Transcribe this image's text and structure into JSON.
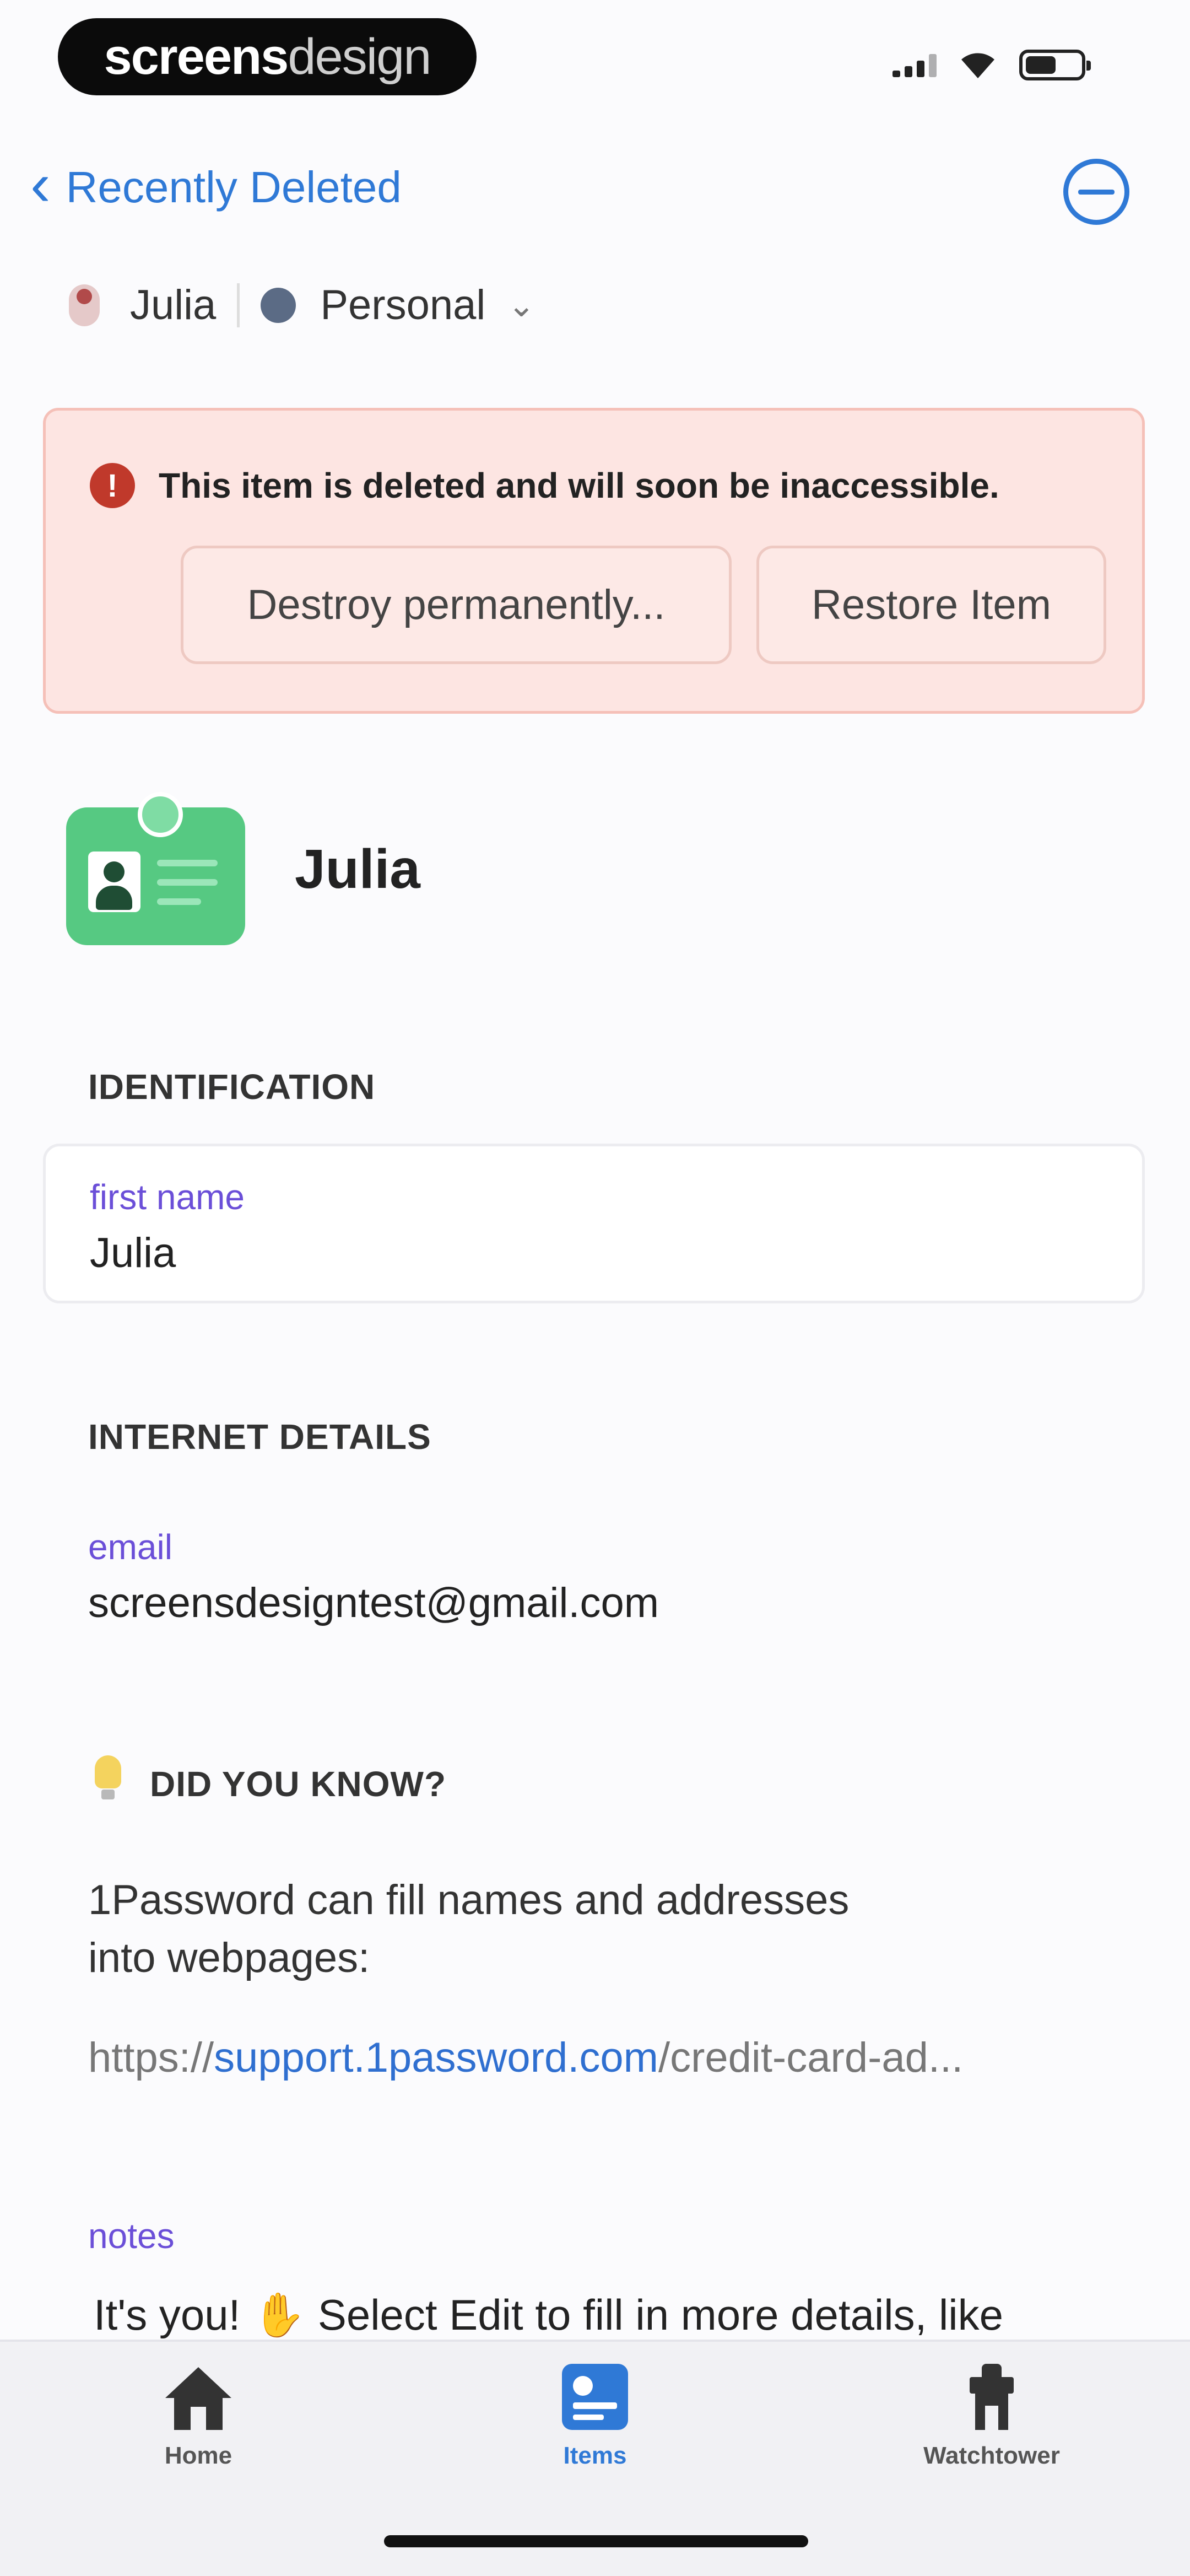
{
  "status_bar": {
    "brand_bold": "screens",
    "brand_light": "design"
  },
  "nav": {
    "back_label": "Recently Deleted",
    "more_icon": "more-circle-icon"
  },
  "account": {
    "user": "Julia",
    "vault": "Personal"
  },
  "deleted_banner": {
    "message": "This item is deleted and will soon be inaccessible.",
    "destroy_label": "Destroy permanently...",
    "restore_label": "Restore Item",
    "accent": "#c0392b",
    "background": "#fde5e2"
  },
  "item": {
    "title": "Julia",
    "icon": "identity-card-icon",
    "icon_color": "#56c982"
  },
  "identification": {
    "section_title": "IDENTIFICATION",
    "first_name_label": "first name",
    "first_name_value": "Julia"
  },
  "internet_details": {
    "section_title": "INTERNET DETAILS",
    "email_label": "email",
    "email_value": "screensdesigntest@gmail.com"
  },
  "did_you_know": {
    "title": "DID YOU KNOW?",
    "line1": "1Password can fill names and addresses",
    "line2": "into webpages:",
    "link_prefix": "https://",
    "link_host": "support.1password.com",
    "link_suffix": "/credit-card-ad..."
  },
  "notes": {
    "label": "notes",
    "text_before": "It's you!",
    "emoji": "✋",
    "text_after": "Select Edit to fill in more details, like"
  },
  "tab_bar": {
    "tabs": [
      {
        "label": "Home",
        "icon": "home-icon",
        "active": false
      },
      {
        "label": "Items",
        "icon": "items-icon",
        "active": true
      },
      {
        "label": "Watchtower",
        "icon": "watchtower-icon",
        "active": false
      }
    ],
    "active_color": "#2f79d6"
  }
}
